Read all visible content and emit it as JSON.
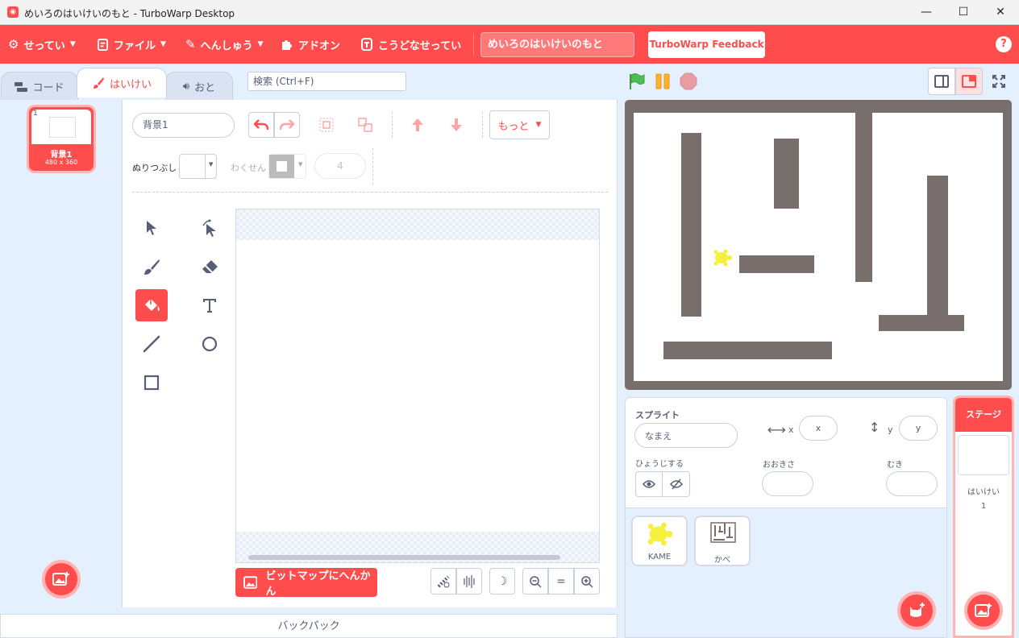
{
  "window": {
    "title": "めいろのはいけいのもと - TurboWarp Desktop",
    "minimize": "—",
    "maximize": "☐",
    "close": "✕"
  },
  "menubar": {
    "settings": "せってい",
    "file": "ファイル",
    "edit": "へんしゅう",
    "addons": "アドオン",
    "howto": "こうどなせってい",
    "project_title": "めいろのはいけいのもと",
    "feedback": "TurboWarp Feedback",
    "help": "?"
  },
  "tabs": {
    "code": "コード",
    "costumes": "はいけい",
    "sounds": "おと",
    "search_placeholder": "検索 (Ctrl+F)"
  },
  "costumes": [
    {
      "number": "1",
      "name": "背景1",
      "size": "480 x 360"
    }
  ],
  "editor": {
    "costume_name": "背景1",
    "more": "もっと",
    "fill_label": "ぬりつぶし",
    "outline_label": "わくせん",
    "outline_width": "4",
    "convert_button": "ビットマップにへんかん",
    "zoom_reset": "="
  },
  "backpack": "バックパック",
  "sprite_info": {
    "sprite_label": "スプライト",
    "name_placeholder": "なまえ",
    "x_label": "x",
    "x_placeholder": "x",
    "y_label": "y",
    "y_placeholder": "y",
    "show_label": "ひょうじする",
    "size_label": "おおきさ",
    "direction_label": "むき"
  },
  "sprites": [
    {
      "name": "KAME"
    },
    {
      "name": "かべ"
    }
  ],
  "stage_target": {
    "header": "ステージ",
    "backdrops_label": "はいけい",
    "backdrops_count": "1"
  },
  "colors": {
    "accent": "#ff4c4c",
    "wall": "#786e6c",
    "turtle": "#f5f03c"
  }
}
